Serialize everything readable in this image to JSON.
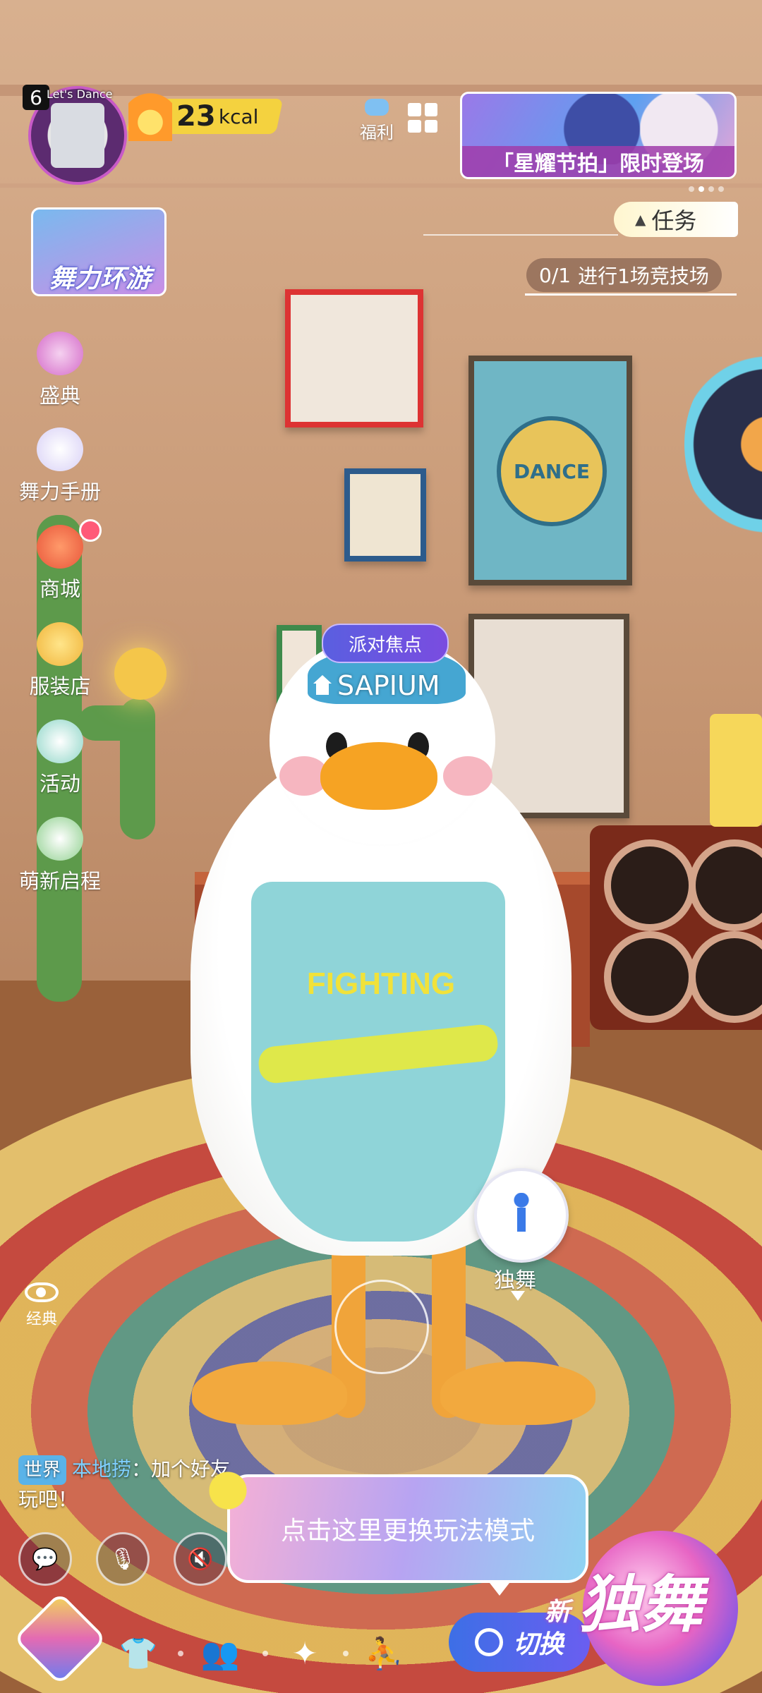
{
  "player": {
    "level": "6",
    "avatar_caption": "Let's Dance",
    "kcal_value": "23",
    "kcal_unit": "kcal",
    "name": "SAPIUM",
    "party_tag": "派对焦点"
  },
  "top": {
    "welfare_label": "福利",
    "banner_text": "「星耀节拍」限时登场"
  },
  "task": {
    "button_label": "任务",
    "progress": "0/1",
    "description": "进行1场竞技场"
  },
  "sidebar": {
    "promo_label": "舞力环游",
    "items": [
      {
        "label": "盛典",
        "icon": "ceremony-icon"
      },
      {
        "label": "舞力手册",
        "icon": "dance-manual-icon"
      },
      {
        "label": "商城",
        "icon": "shop-cart-icon"
      },
      {
        "label": "服装店",
        "icon": "clothing-bag-icon"
      },
      {
        "label": "活动",
        "icon": "star-music-icon"
      },
      {
        "label": "萌新启程",
        "icon": "newbie-icon"
      }
    ]
  },
  "scene": {
    "shirt_text": "FIGHTING",
    "poster_text": "DANCE"
  },
  "controls": {
    "view_label": "经典",
    "solo_label": "独舞"
  },
  "chat": {
    "channel": "世界",
    "user": "本地捞",
    "message": "：加个好友",
    "message_cont": "玩吧！"
  },
  "tip": {
    "text": "点击这里更换玩法模式"
  },
  "bottom": {
    "switch_label": "切换",
    "new_badge": "新",
    "mode_label": "独舞"
  },
  "colors": {
    "accent_purple": "#6a5ef0",
    "kcal_yellow": "#f4d23f",
    "notification": "#ff5a78"
  }
}
